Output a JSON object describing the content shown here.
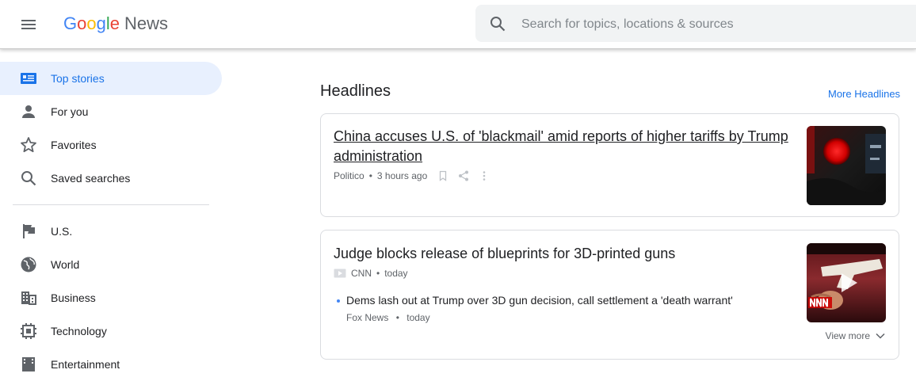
{
  "header": {
    "logo_letters": [
      "G",
      "o",
      "o",
      "g",
      "l",
      "e"
    ],
    "product": "News",
    "search_placeholder": "Search for topics, locations & sources",
    "icons": {
      "menu": "hamburger-menu-icon",
      "search": "search-icon"
    }
  },
  "sidebar": {
    "items": [
      {
        "label": "Top stories",
        "icon": "top-stories-icon",
        "active": true
      },
      {
        "label": "For you",
        "icon": "person-icon",
        "active": false
      },
      {
        "label": "Favorites",
        "icon": "star-icon",
        "active": false
      },
      {
        "label": "Saved searches",
        "icon": "search-icon",
        "active": false
      },
      {
        "label": "U.S.",
        "icon": "flag-icon",
        "active": false
      },
      {
        "label": "World",
        "icon": "globe-icon",
        "active": false
      },
      {
        "label": "Business",
        "icon": "building-icon",
        "active": false
      },
      {
        "label": "Technology",
        "icon": "chip-icon",
        "active": false
      },
      {
        "label": "Entertainment",
        "icon": "film-icon",
        "active": false
      }
    ]
  },
  "main": {
    "section_title": "Headlines",
    "more_link": "More Headlines",
    "articles": [
      {
        "title": "China accuses U.S. of 'blackmail' amid reports of higher tariffs by Trump administration",
        "source": "Politico",
        "time": "3 hours ago",
        "actions": [
          "bookmark-icon",
          "share-icon",
          "more-vert-icon"
        ]
      },
      {
        "title": "Judge blocks release of blueprints for 3D-printed guns",
        "source": "CNN",
        "time": "today",
        "source_icon": "video-icon",
        "related": {
          "title": "Dems lash out at Trump over 3D gun decision, call settlement a 'death warrant'",
          "source": "Fox News",
          "time": "today"
        },
        "view_more": "View more"
      }
    ]
  },
  "colors": {
    "accent": "#1a73e8",
    "active_bg": "#e8f0fe",
    "google_blue": "#4285F4",
    "google_red": "#EA4335",
    "google_yellow": "#FBBC05",
    "google_green": "#34A853"
  }
}
